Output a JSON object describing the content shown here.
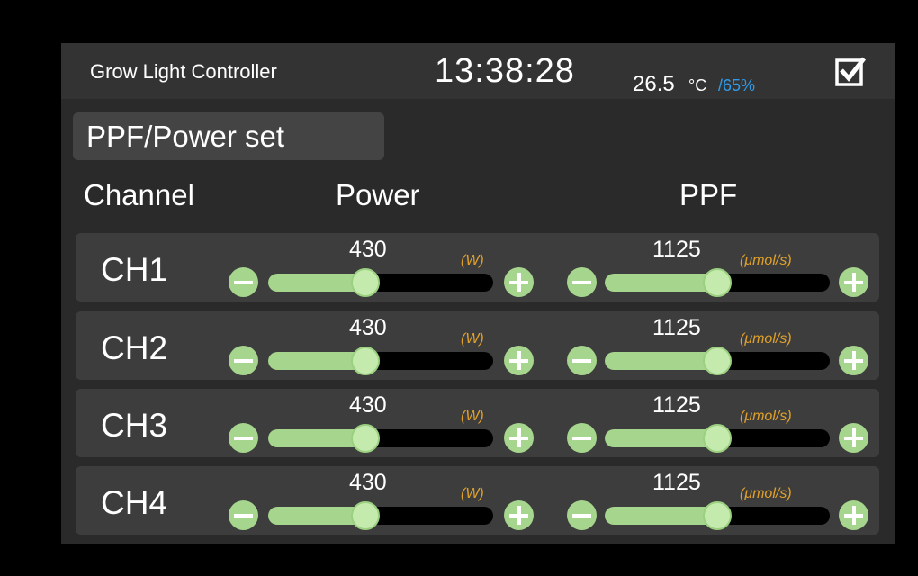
{
  "header": {
    "title": "Grow Light Controller",
    "time": "13:38:28",
    "temperature": "26.5",
    "temperature_unit": "°C",
    "humidity": "/65%",
    "check_icon": "checkbox-checked-icon"
  },
  "section_button": "PPF/Power set",
  "columns": {
    "channel": "Channel",
    "power": "Power",
    "ppf": "PPF"
  },
  "colors": {
    "accent_green": "#a6d58d",
    "humidity_blue": "#2f9bea",
    "unit_orange": "#e0a12a"
  },
  "channels": [
    {
      "label": "CH1",
      "power_value": "430",
      "power_unit": "(W)",
      "power_level": 0.43,
      "ppf_value": "1125",
      "ppf_unit": "(μmol/s)",
      "ppf_level": 0.5
    },
    {
      "label": "CH2",
      "power_value": "430",
      "power_unit": "(W)",
      "power_level": 0.43,
      "ppf_value": "1125",
      "ppf_unit": "(μmol/s)",
      "ppf_level": 0.5
    },
    {
      "label": "CH3",
      "power_value": "430",
      "power_unit": "(W)",
      "power_level": 0.43,
      "ppf_value": "1125",
      "ppf_unit": "(μmol/s)",
      "ppf_level": 0.5
    },
    {
      "label": "CH4",
      "power_value": "430",
      "power_unit": "(W)",
      "power_level": 0.43,
      "ppf_value": "1125",
      "ppf_unit": "(μmol/s)",
      "ppf_level": 0.5
    }
  ]
}
